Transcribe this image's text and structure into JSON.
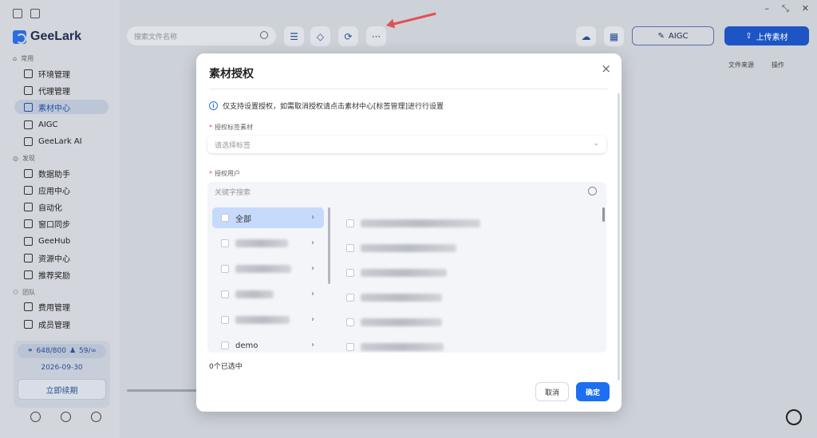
{
  "app": {
    "name": "GeeLark"
  },
  "sidebar": {
    "sections": [
      {
        "label": "常用"
      },
      {
        "label": "发现"
      },
      {
        "label": "团队"
      }
    ],
    "items": [
      {
        "label": "环境管理",
        "icon": "environment-icon"
      },
      {
        "label": "代理管理",
        "icon": "proxy-icon"
      },
      {
        "label": "素材中心",
        "icon": "material-icon",
        "active": true
      },
      {
        "label": "AIGC",
        "icon": "aigc-icon"
      },
      {
        "label": "GeeLark AI",
        "icon": "geelark-ai-icon"
      },
      {
        "label": "数据助手",
        "icon": "data-icon"
      },
      {
        "label": "应用中心",
        "icon": "apps-icon"
      },
      {
        "label": "自动化",
        "icon": "automation-icon"
      },
      {
        "label": "窗口同步",
        "icon": "sync-icon"
      },
      {
        "label": "GeeHub",
        "icon": "geehub-icon"
      },
      {
        "label": "资源中心",
        "icon": "resource-icon"
      },
      {
        "label": "推荐奖励",
        "icon": "reward-icon"
      },
      {
        "label": "费用管理",
        "icon": "billing-icon"
      },
      {
        "label": "成员管理",
        "icon": "members-icon"
      }
    ],
    "quota": {
      "profiles": "648/800",
      "members": "59/∞",
      "expiry": "2026-09-30",
      "renew_label": "立即续期"
    }
  },
  "toolbar": {
    "search_placeholder": "搜索文件名称",
    "aigc_label": "AIGC",
    "upload_label": "上传素材",
    "more_label": "···"
  },
  "table": {
    "col_source": "文件来源",
    "col_action": "操作"
  },
  "window": {
    "minimize": "–",
    "restore": "⤡",
    "close": "✕"
  },
  "modal": {
    "title": "素材授权",
    "close": "×",
    "info": "仅支持设置授权，如需取消授权请点击素材中心[标签管理]进行行设置",
    "tag_label": "授权标签素材",
    "tag_placeholder": "请选择标签",
    "user_label": "授权用户",
    "user_search_placeholder": "关键字搜索",
    "left_items": [
      {
        "label": "全部",
        "selected": true
      },
      {
        "label": ""
      },
      {
        "label": ""
      },
      {
        "label": ""
      },
      {
        "label": ""
      },
      {
        "label": "demo"
      }
    ],
    "selected_count": "0个已选中",
    "cancel_label": "取消",
    "ok_label": "确定"
  }
}
